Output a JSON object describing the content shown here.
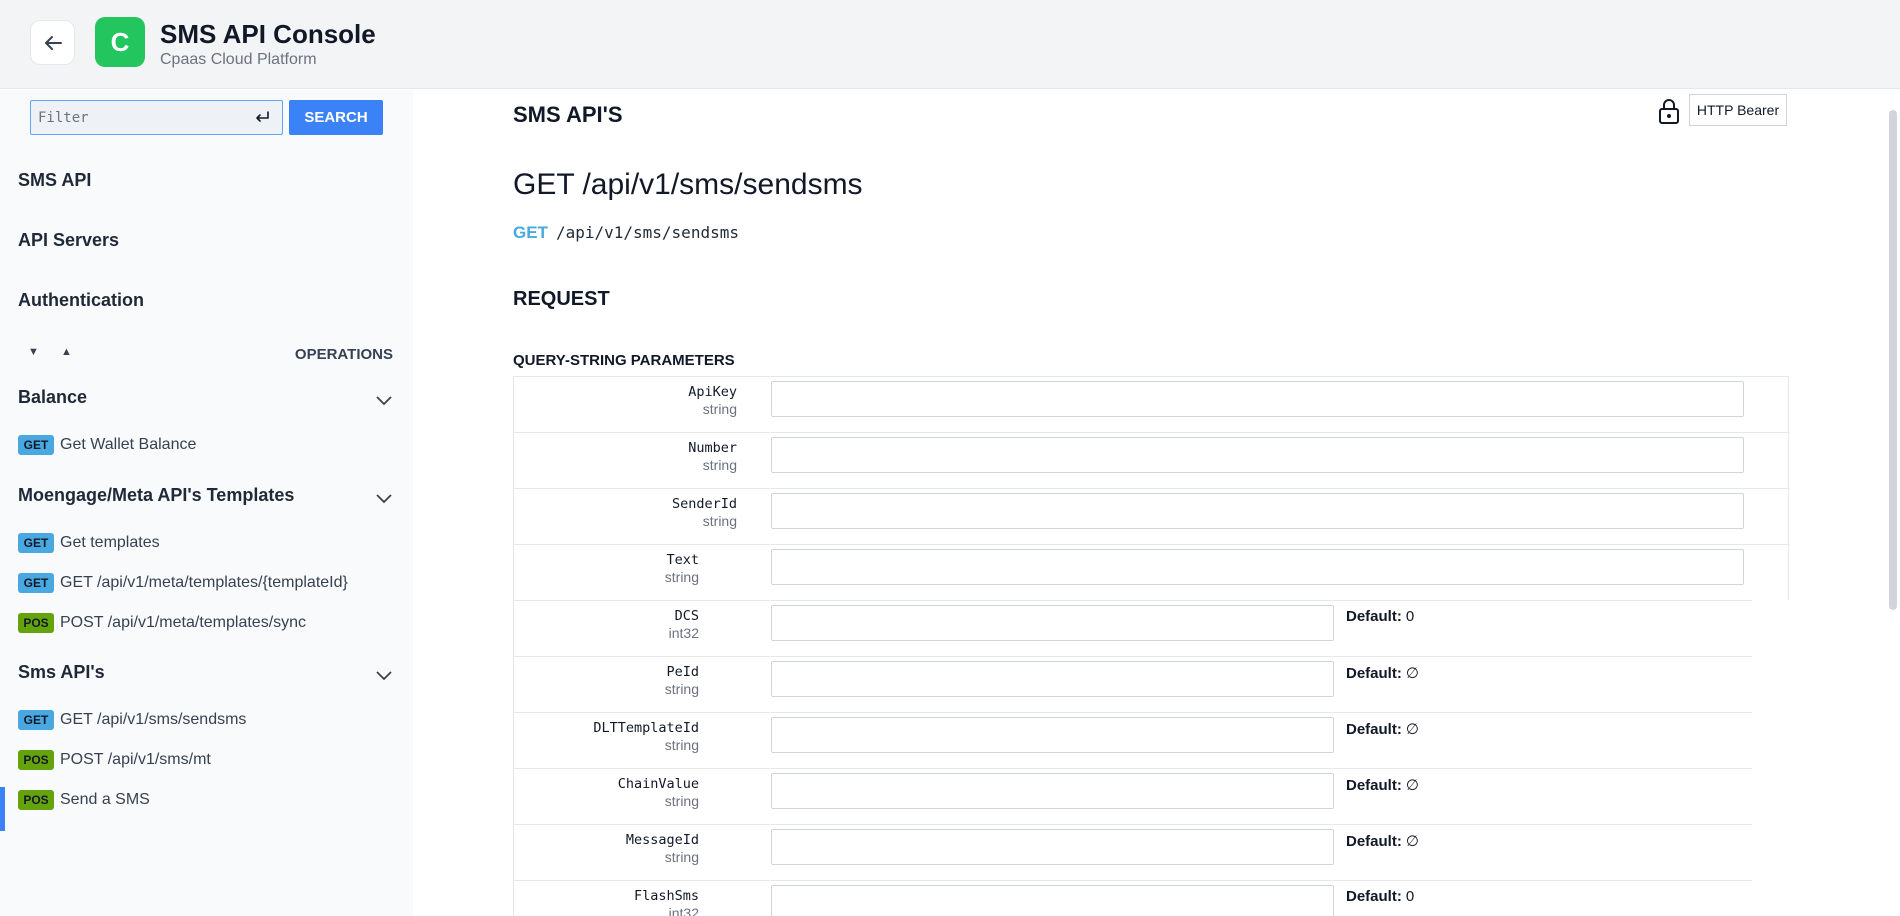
{
  "header": {
    "logo_letter": "C",
    "title": "SMS API Console",
    "subtitle": "Cpaas Cloud Platform"
  },
  "sidebar": {
    "filter_placeholder": "Filter",
    "search_label": "SEARCH",
    "links": [
      "SMS API",
      "API Servers",
      "Authentication"
    ],
    "expand_all": "▼",
    "collapse_all": "▲",
    "operations_label": "OPERATIONS",
    "groups": [
      {
        "title": "Balance",
        "items": [
          {
            "method": "GET",
            "label": "Get Wallet Balance"
          }
        ]
      },
      {
        "title": "Moengage/Meta API's Templates",
        "items": [
          {
            "method": "GET",
            "label": "Get templates"
          },
          {
            "method": "GET",
            "label": "GET /api/v1/meta/templates/{templateId}"
          },
          {
            "method": "POS",
            "label": "POST /api/v1/meta/templates/sync"
          }
        ]
      },
      {
        "title": "Sms API's",
        "items": [
          {
            "method": "GET",
            "label": "GET /api/v1/sms/sendsms"
          },
          {
            "method": "POS",
            "label": "POST /api/v1/sms/mt"
          },
          {
            "method": "POS",
            "label": "Send a SMS"
          }
        ]
      }
    ]
  },
  "main": {
    "section_title": "SMS API'S",
    "auth_label": "HTTP Bearer",
    "endpoint_title": "GET /api/v1/sms/sendsms",
    "method": "GET",
    "path": "/api/v1/sms/sendsms",
    "request_heading": "REQUEST",
    "query_heading": "QUERY-STRING PARAMETERS",
    "default_label": "Default:",
    "params": [
      {
        "name": "ApiKey",
        "type": "string"
      },
      {
        "name": "Number",
        "type": "string"
      },
      {
        "name": "SenderId",
        "type": "string"
      },
      {
        "name": "Text",
        "type": "string"
      },
      {
        "name": "DCS",
        "type": "int32",
        "default": "0"
      },
      {
        "name": "PeId",
        "type": "string",
        "default": "∅"
      },
      {
        "name": "DLTTemplateId",
        "type": "string",
        "default": "∅"
      },
      {
        "name": "ChainValue",
        "type": "string",
        "default": "∅"
      },
      {
        "name": "MessageId",
        "type": "string",
        "default": "∅"
      },
      {
        "name": "FlashSms",
        "type": "int32",
        "default": "0"
      }
    ]
  }
}
